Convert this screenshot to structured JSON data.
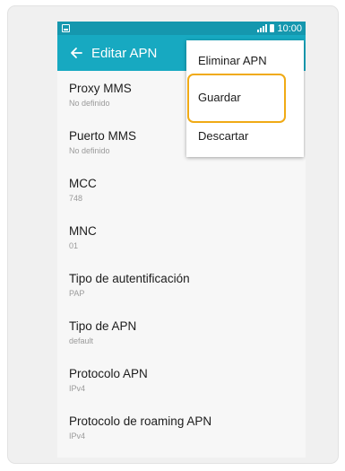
{
  "status_bar": {
    "time": "10:00"
  },
  "app_bar": {
    "title": "Editar APN",
    "back_icon": "arrow-left-icon"
  },
  "settings": [
    {
      "title": "Proxy MMS",
      "value": "No definido"
    },
    {
      "title": "Puerto MMS",
      "value": "No definido"
    },
    {
      "title": "MCC",
      "value": "748"
    },
    {
      "title": "MNC",
      "value": "01"
    },
    {
      "title": "Tipo de autentificación",
      "value": "PAP"
    },
    {
      "title": "Tipo de APN",
      "value": "default"
    },
    {
      "title": "Protocolo APN",
      "value": "IPv4"
    },
    {
      "title": "Protocolo de roaming APN",
      "value": "IPv4"
    }
  ],
  "menu": {
    "items": [
      "Eliminar APN",
      "Guardar",
      "Descartar"
    ],
    "highlighted": "Guardar"
  },
  "colors": {
    "status_bar": "#1597ae",
    "app_bar": "#17a9c1",
    "highlight": "#f0aa15"
  }
}
